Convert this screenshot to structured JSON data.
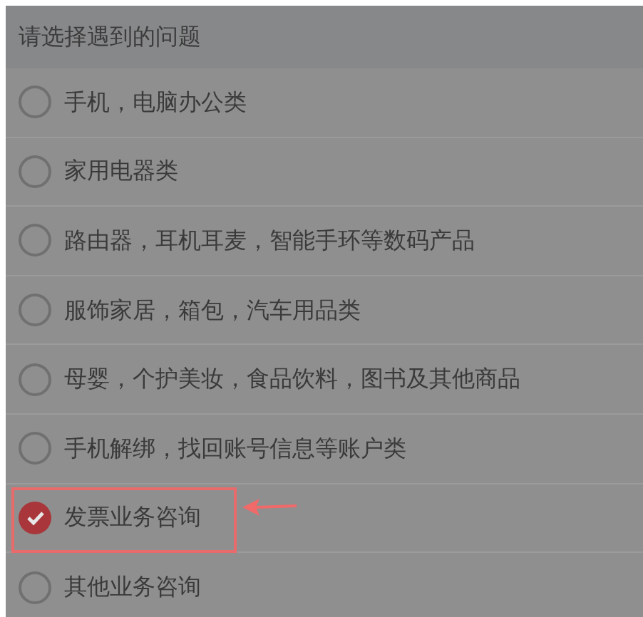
{
  "title": "请选择遇到的问题",
  "options": [
    {
      "label": "手机，电脑办公类",
      "selected": false
    },
    {
      "label": "家用电器类",
      "selected": false
    },
    {
      "label": "路由器，耳机耳麦，智能手环等数码产品",
      "selected": false
    },
    {
      "label": "服饰家居，箱包，汽车用品类",
      "selected": false
    },
    {
      "label": "母婴，个护美妆，食品饮料，图书及其他商品",
      "selected": false
    },
    {
      "label": "手机解绑，找回账号信息等账户类",
      "selected": false
    },
    {
      "label": "发票业务咨询",
      "selected": true,
      "highlighted": true
    },
    {
      "label": "其他业务咨询",
      "selected": false
    }
  ]
}
